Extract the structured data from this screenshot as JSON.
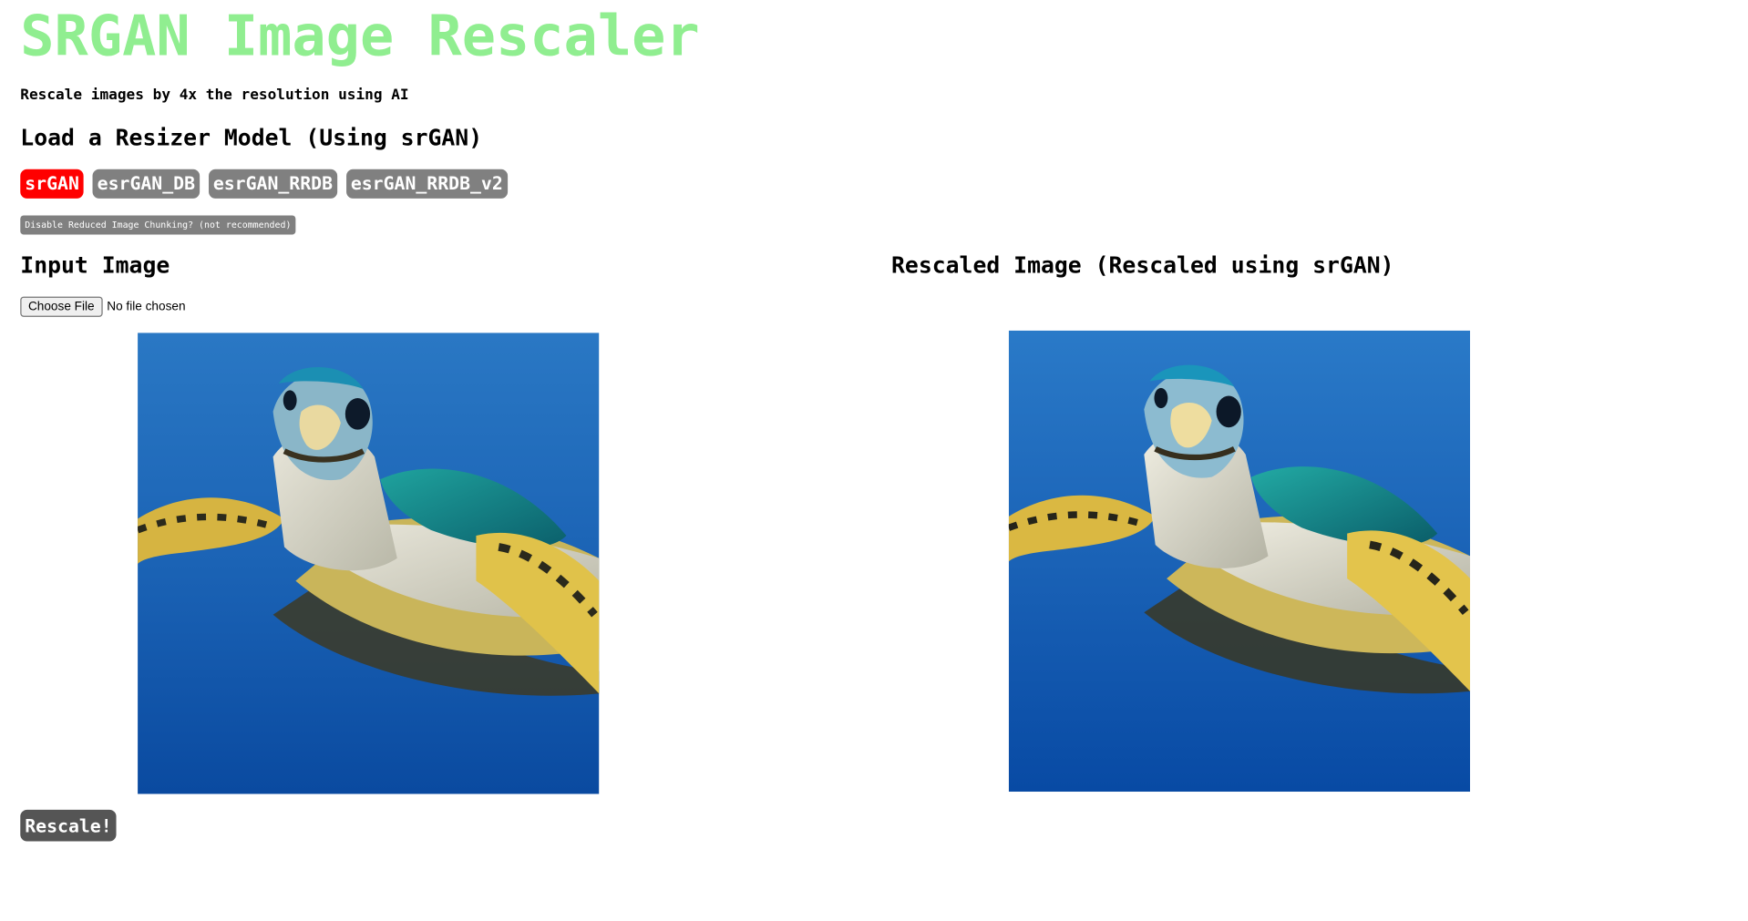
{
  "header": {
    "title": "SRGAN Image Rescaler",
    "subtitle": "Rescale images by 4x the resolution using AI"
  },
  "models": {
    "heading": "Load a Resizer Model (Using srGAN)",
    "items": [
      {
        "label": "srGAN",
        "active": true
      },
      {
        "label": "esrGAN_DB",
        "active": false
      },
      {
        "label": "esrGAN_RRDB",
        "active": false
      },
      {
        "label": "esrGAN_RRDB_v2",
        "active": false
      }
    ],
    "chunk_toggle_label": "Disable Reduced Image Chunking? (not recommended)"
  },
  "input": {
    "heading": "Input Image",
    "choose_file_label": "Choose File",
    "file_status": "No file chosen"
  },
  "output": {
    "heading": "Rescaled Image (Rescaled using srGAN)"
  },
  "actions": {
    "rescale_label": "Rescale!"
  },
  "colors": {
    "title": "#90ee90",
    "active_model": "#ff0000",
    "inactive_model": "#808080",
    "rescale_button": "#555555"
  }
}
